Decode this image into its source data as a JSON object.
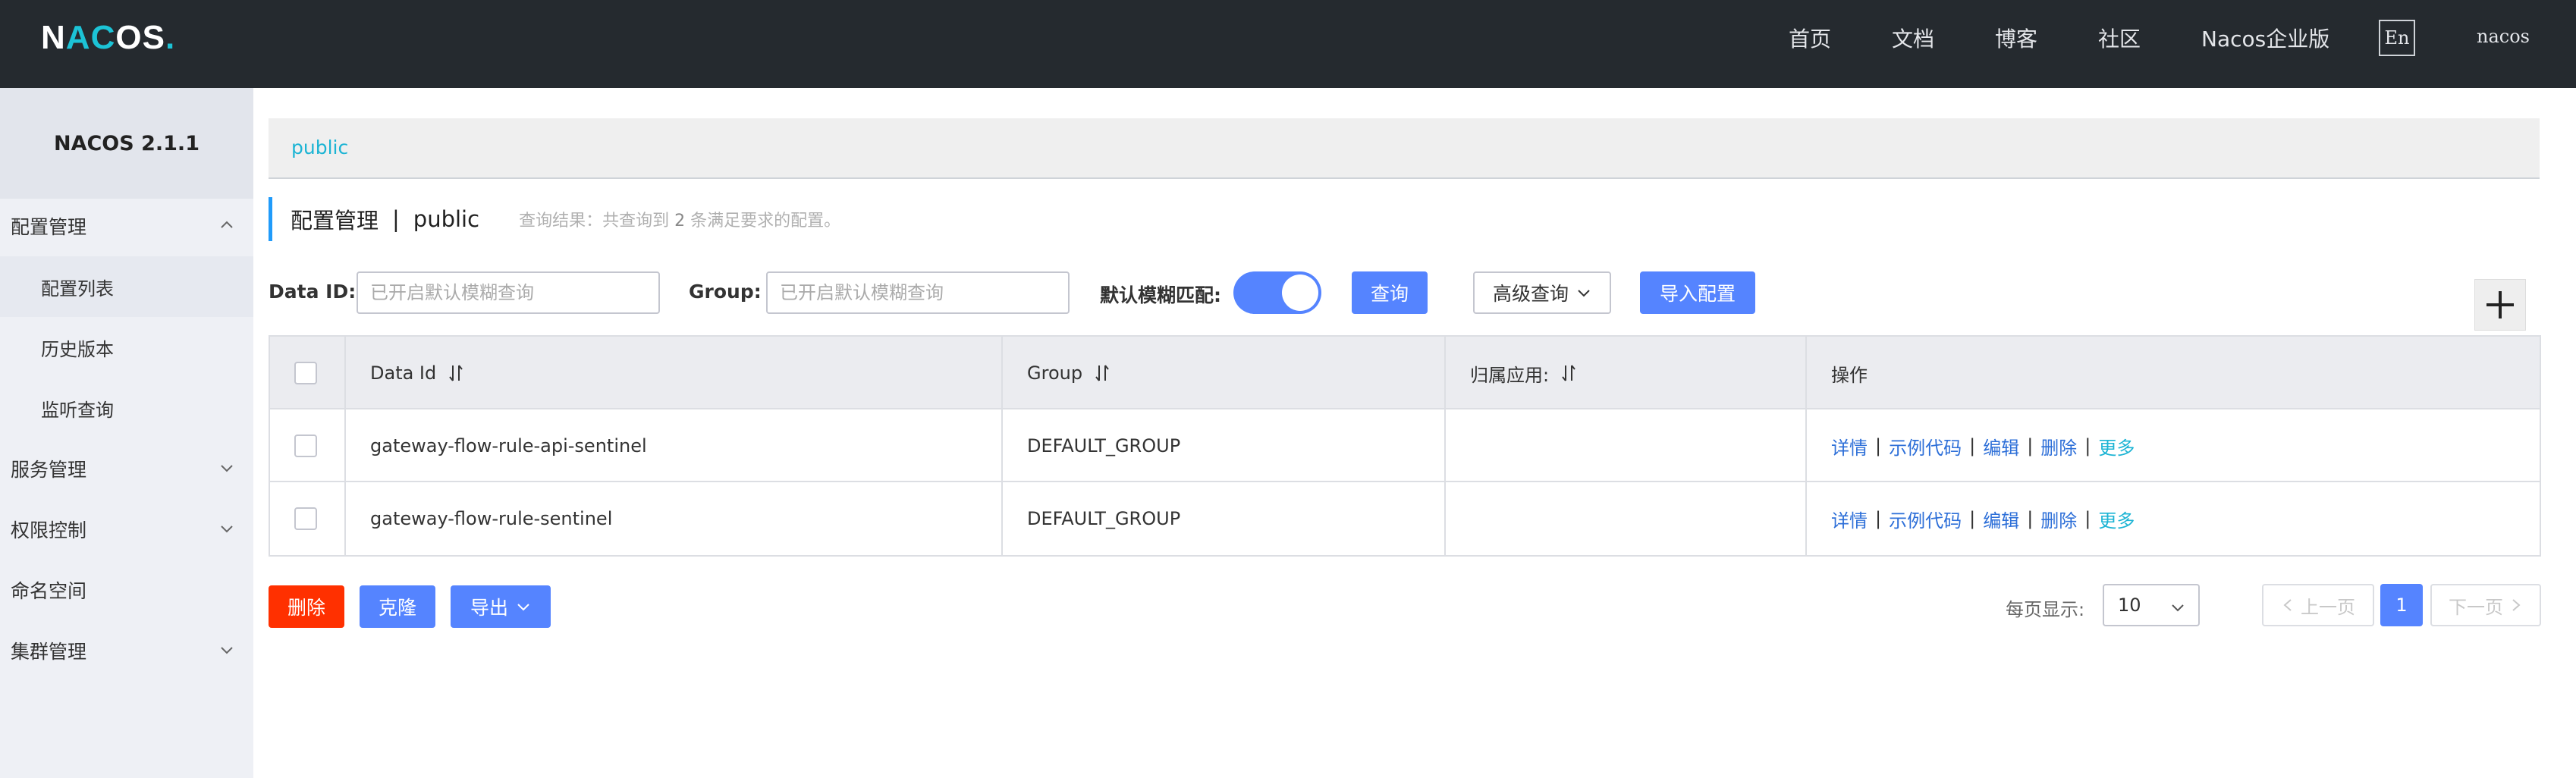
{
  "header": {
    "logo": {
      "n": "N",
      "a": "A",
      "c": "C",
      "o": "O",
      "s": "S",
      "dot": "."
    },
    "nav": [
      "首页",
      "文档",
      "博客",
      "社区",
      "Nacos企业版"
    ],
    "lang": "En",
    "user": "nacos"
  },
  "sidebar": {
    "version": "NACOS 2.1.1",
    "groups": [
      {
        "label": "配置管理",
        "expanded": true,
        "items": [
          "配置列表",
          "历史版本",
          "监听查询"
        ]
      },
      {
        "label": "服务管理",
        "expanded": false
      },
      {
        "label": "权限控制",
        "expanded": false
      },
      {
        "label": "命名空间"
      },
      {
        "label": "集群管理",
        "expanded": false
      }
    ]
  },
  "namespace": {
    "current": "public"
  },
  "page": {
    "title": "配置管理",
    "separator": "|",
    "namespace": "public",
    "result_prefix": "查询结果：共查询到",
    "result_count": "2",
    "result_suffix": "条满足要求的配置。"
  },
  "filters": {
    "dataid_label": "Data ID:",
    "dataid_placeholder": "已开启默认模糊查询",
    "group_label": "Group:",
    "group_placeholder": "已开启默认模糊查询",
    "fuzzy_label": "默认模糊匹配:",
    "fuzzy_on": true,
    "query_button": "查询",
    "advanced_button": "高级查询",
    "import_button": "导入配置"
  },
  "table": {
    "columns": [
      "Data Id",
      "Group",
      "归属应用:",
      "操作"
    ],
    "rows": [
      {
        "data_id": "gateway-flow-rule-api-sentinel",
        "group": "DEFAULT_GROUP",
        "app": ""
      },
      {
        "data_id": "gateway-flow-rule-sentinel",
        "group": "DEFAULT_GROUP",
        "app": ""
      }
    ],
    "ops": {
      "detail": "详情",
      "sample": "示例代码",
      "edit": "编辑",
      "delete": "删除",
      "more": "更多",
      "sep": "|"
    }
  },
  "bottom": {
    "delete_button": "删除",
    "clone_button": "克隆",
    "export_button": "导出",
    "pagesize_label": "每页显示:",
    "pagesize_value": "10",
    "prev": "上一页",
    "next": "下一页",
    "current_page": "1"
  },
  "colors": {
    "header_bg": "#252a2f",
    "primary": "#5584ff",
    "danger": "#ff3000",
    "link": "#2d6fd8",
    "accent": "#1cb4d4"
  }
}
